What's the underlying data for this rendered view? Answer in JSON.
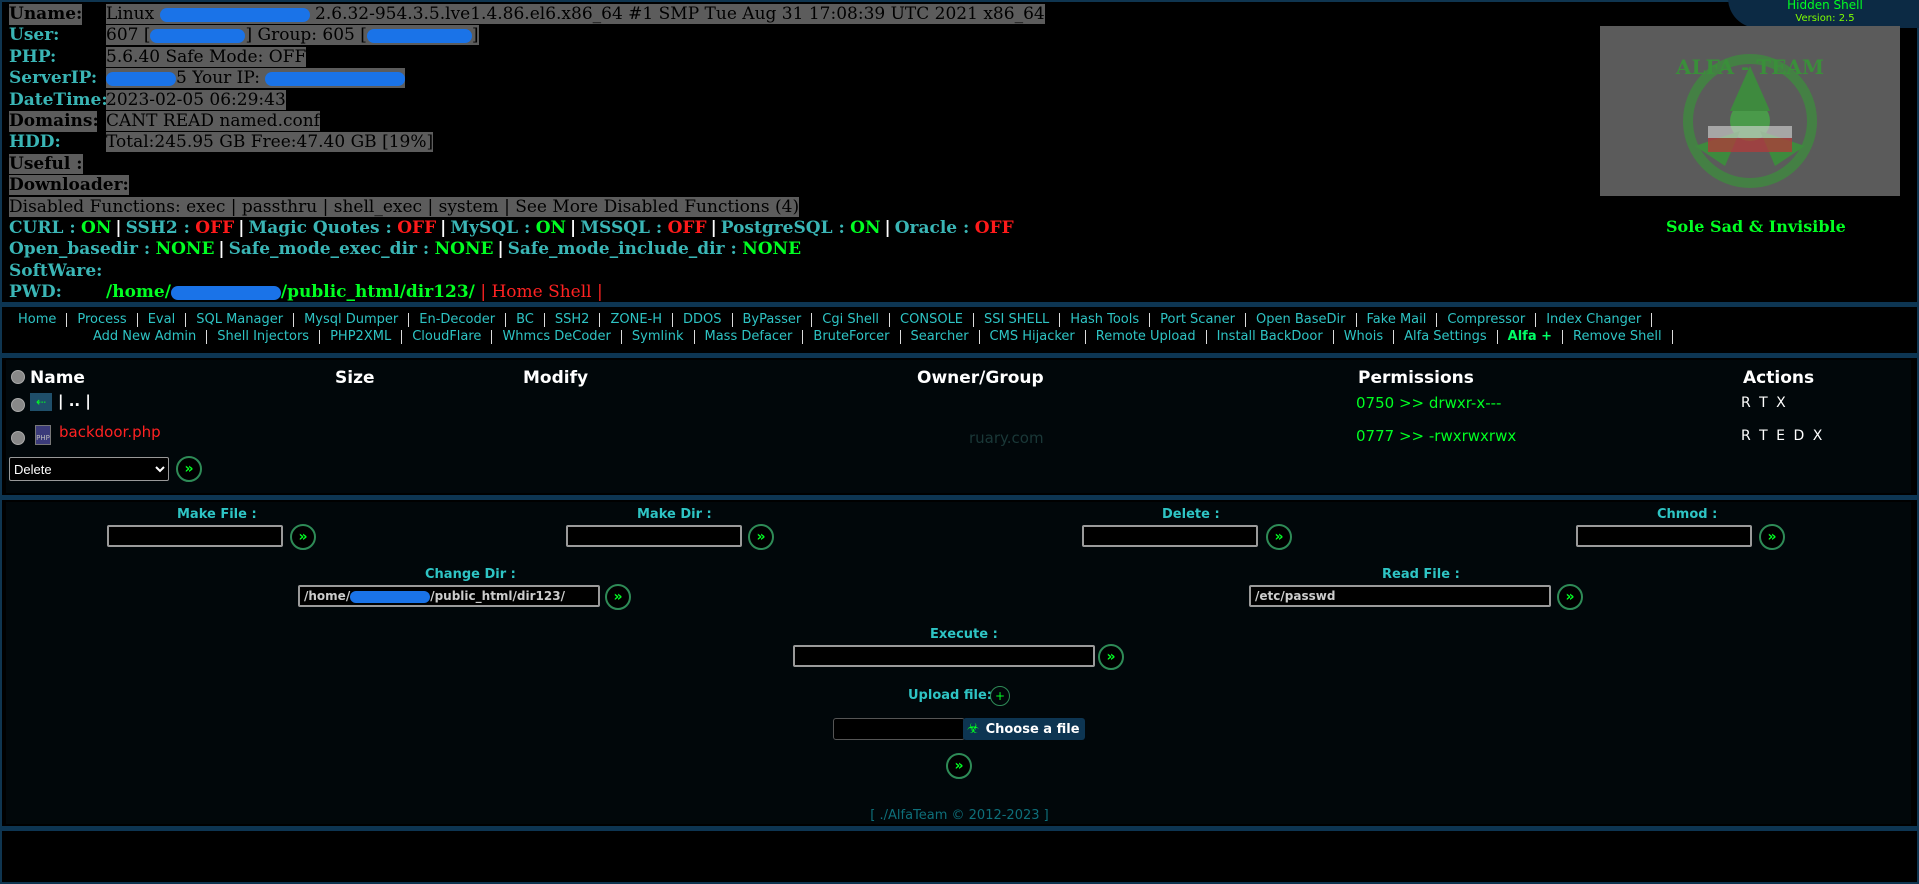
{
  "info": {
    "uname_label": "Uname:",
    "uname_value": "Linux",
    "uname_rest": "2.6.32-954.3.5.lve1.4.86.el6.x86_64 #1 SMP Tue Aug 31 17:08:39 UTC 2021 x86_64",
    "user_label": "User:",
    "user_uid": "607 [",
    "user_group": "] Group: 605 [",
    "user_end": "]",
    "php_label": "PHP:",
    "php_value": "5.6.40 Safe Mode: OFF",
    "serverip_label": "ServerIP:",
    "serverip_mid": "5 Your IP:",
    "datetime_label": "DateTime:",
    "datetime_value": "2023-02-05 06:29:43",
    "domains_label": "Domains:",
    "domains_value": "CANT READ named.conf",
    "hdd_label": "HDD:",
    "hdd_value": "Total:245.95 GB Free:47.40 GB [19%]",
    "useful_label": "Useful :",
    "downloader_label": "Downloader:",
    "disabled_text": "Disabled Functions: exec | passthru | shell_exec | system | See More Disabled Functions (4)",
    "curl_label": "CURL :",
    "curl_value": "ON",
    "ssh2_label": "SSH2 :",
    "ssh2_value": "OFF",
    "magic_label": "Magic Quotes :",
    "magic_value": "OFF",
    "mysql_label": "MySQL :",
    "mysql_value": "ON",
    "mssql_label": "MSSQL :",
    "mssql_value": "OFF",
    "pg_label": "PostgreSQL :",
    "pg_value": "ON",
    "oracle_label": "Oracle :",
    "oracle_value": "OFF",
    "openbase_label": "Open_basedir :",
    "openbase_value": "NONE",
    "safeexec_label": "Safe_mode_exec_dir :",
    "safeexec_value": "NONE",
    "safeinc_label": "Safe_mode_include_dir :",
    "safeinc_value": "NONE",
    "software_label": "SoftWare:",
    "pwd_label": "PWD:",
    "pwd_start": "/home/",
    "pwd_end": "/public_html/dir123/",
    "home_shell": "| Home Shell |"
  },
  "brand": {
    "title": "Hidden Shell",
    "version": "Version: 2.5",
    "logo_text": "ALFA - TEAM",
    "tagline": "Sole Sad & Invisible"
  },
  "nav": {
    "row1": [
      "Home",
      "Process",
      "Eval",
      "SQL Manager",
      "Mysql Dumper",
      "En-Decoder",
      "BC",
      "SSH2",
      "ZONE-H",
      "DDOS",
      "ByPasser",
      "Cgi Shell",
      "CONSOLE",
      "SSI SHELL",
      "Hash Tools",
      "Port Scaner",
      "Open BaseDir",
      "Fake Mail",
      "Compressor",
      "Index Changer"
    ],
    "row2": [
      "Add New Admin",
      "Shell Injectors",
      "PHP2XML",
      "CloudFlare",
      "Whmcs DeCoder",
      "Symlink",
      "Mass Defacer",
      "BruteForcer",
      "Searcher",
      "CMS Hijacker",
      "Remote Upload",
      "Install BackDoor",
      "Whois",
      "Alfa Settings",
      "Alfa +",
      "Remove Shell"
    ]
  },
  "table": {
    "headers": {
      "name": "Name",
      "size": "Size",
      "modify": "Modify",
      "owner": "Owner/Group",
      "perms": "Permissions",
      "actions": "Actions"
    },
    "rows": [
      {
        "name": "| .. |",
        "perm_octal": "0750",
        "perm_arrow": ">>",
        "perm_str": "drwxr-x---",
        "actions": "R T X"
      },
      {
        "name": "backdoor.php",
        "owner_hint": "ruary.com",
        "perm_octal": "0777",
        "perm_arrow": ">>",
        "perm_str": "-rwxrwxrwx",
        "actions": "R T E D X"
      }
    ],
    "bulk_action": "Delete"
  },
  "forms": {
    "make_file": "Make File :",
    "make_dir": "Make Dir :",
    "delete": "Delete :",
    "chmod": "Chmod :",
    "change_dir": "Change Dir :",
    "change_dir_start": "/home/",
    "change_dir_end": "/public_html/dir123/",
    "read_file": "Read File :",
    "read_file_value": "/etc/passwd",
    "execute": "Execute :",
    "upload": "Upload file:",
    "choose": "Choose a file"
  },
  "footer": "[ ./AlfaTeam © 2012-2023 ]"
}
